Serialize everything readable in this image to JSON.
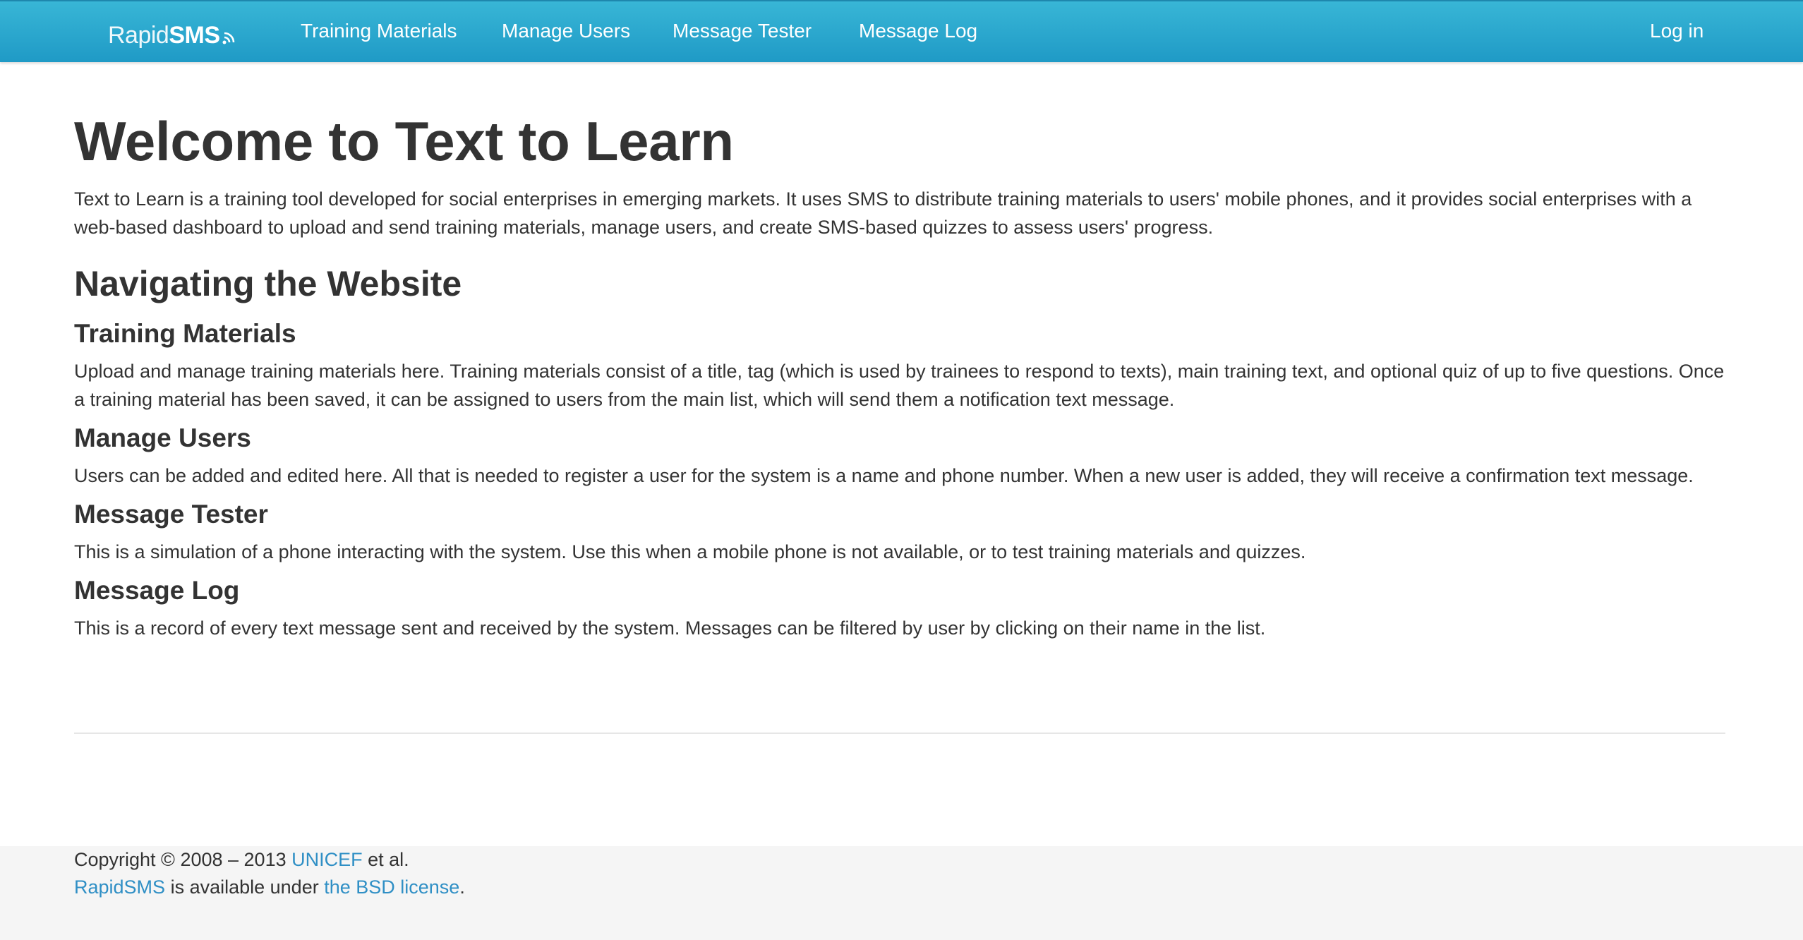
{
  "nav": {
    "brand_light": "Rapid",
    "brand_bold": "SMS",
    "links": [
      "Training Materials",
      "Manage Users",
      "Message Tester",
      "Message Log"
    ],
    "login": "Log in"
  },
  "main": {
    "title": "Welcome to Text to Learn",
    "intro": "Text to Learn is a training tool developed for social enterprises in emerging markets. It uses SMS to distribute training materials to users' mobile phones, and it provides social enterprises with a web-based dashboard to upload and send training materials, manage users, and create SMS-based quizzes to assess users' progress.",
    "nav_heading": "Navigating the Website",
    "sections": [
      {
        "heading": "Training Materials",
        "text": "Upload and manage training materials here. Training materials consist of a title, tag (which is used by trainees to respond to texts), main training text, and optional quiz of up to five questions. Once a training material has been saved, it can be assigned to users from the main list, which will send them a notification text message."
      },
      {
        "heading": "Manage Users",
        "text": "Users can be added and edited here. All that is needed to register a user for the system is a name and phone number. When a new user is added, they will receive a confirmation text message."
      },
      {
        "heading": "Message Tester",
        "text": "This is a simulation of a phone interacting with the system. Use this when a mobile phone is not available, or to test training materials and quizzes."
      },
      {
        "heading": "Message Log",
        "text": "This is a record of every text message sent and received by the system. Messages can be filtered by user by clicking on their name in the list."
      }
    ]
  },
  "footer": {
    "copyright_prefix": "Copyright © 2008 – 2013 ",
    "unicef_link": "UNICEF",
    "copyright_suffix": " et al.",
    "rapidsms_link": "RapidSMS",
    "license_middle": " is available under ",
    "license_link": "the BSD license",
    "license_end": "."
  }
}
